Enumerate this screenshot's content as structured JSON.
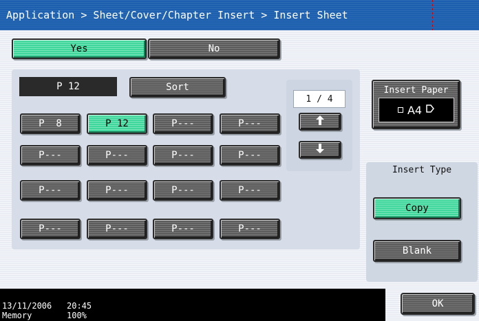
{
  "breadcrumb": {
    "text": "Application > Sheet/Cover/Chapter Insert > Insert Sheet"
  },
  "toggle": {
    "yes": "Yes",
    "no": "No",
    "selected": "Yes"
  },
  "page_display": "P 12",
  "sort_label": "Sort",
  "page_buttons": [
    {
      "label": "P  8",
      "selected": false
    },
    {
      "label": "P 12",
      "selected": true
    },
    {
      "label": "P---",
      "selected": false
    },
    {
      "label": "P---",
      "selected": false
    },
    {
      "label": "P---",
      "selected": false
    },
    {
      "label": "P---",
      "selected": false
    },
    {
      "label": "P---",
      "selected": false
    },
    {
      "label": "P---",
      "selected": false
    },
    {
      "label": "P---",
      "selected": false
    },
    {
      "label": "P---",
      "selected": false
    },
    {
      "label": "P---",
      "selected": false
    },
    {
      "label": "P---",
      "selected": false
    },
    {
      "label": "P---",
      "selected": false
    },
    {
      "label": "P---",
      "selected": false
    },
    {
      "label": "P---",
      "selected": false
    },
    {
      "label": "P---",
      "selected": false
    }
  ],
  "pager": {
    "text": "1 / 4",
    "up_icon": "arrow-up-icon",
    "down_icon": "arrow-down-icon"
  },
  "insert_paper": {
    "title": "Insert Paper",
    "tray": "A4"
  },
  "insert_type": {
    "title": "Insert Type",
    "copy": "Copy",
    "blank": "Blank",
    "selected": "Copy"
  },
  "ok_label": "OK",
  "status": {
    "date": "13/11/2006",
    "time": "20:45",
    "memory_label": "Memory",
    "memory_value": "100%"
  },
  "colors": {
    "title_bg": "#1b5fae",
    "selected": "#3fd79b",
    "button": "#5c5c5c"
  }
}
